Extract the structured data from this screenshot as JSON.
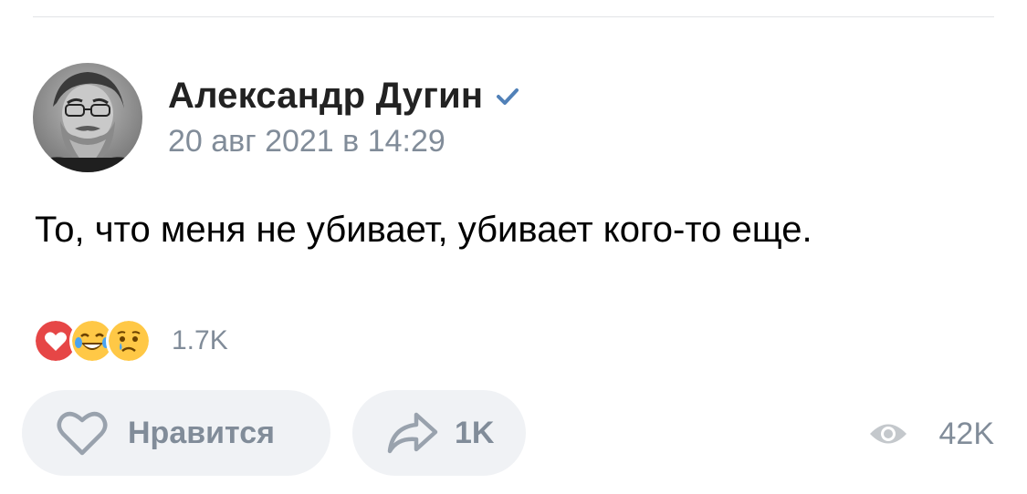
{
  "post": {
    "author": {
      "name": "Александр Дугин",
      "verified": true,
      "avatar": "author-portrait"
    },
    "date": "20 авг 2021 в 14:29",
    "text": "То, что меня не убивает, убивает кого-то еще."
  },
  "reactions": {
    "icons": [
      "heart-reaction",
      "laughing-tears-reaction",
      "crying-reaction"
    ],
    "count": "1.7K"
  },
  "actions": {
    "like_label": "Нравится",
    "share_count": "1K"
  },
  "views": {
    "count": "42K"
  },
  "colors": {
    "accent_blue": "#5181b8",
    "muted_text": "#818c99",
    "button_bg": "#f0f2f5",
    "heart_red": "#e64646"
  }
}
